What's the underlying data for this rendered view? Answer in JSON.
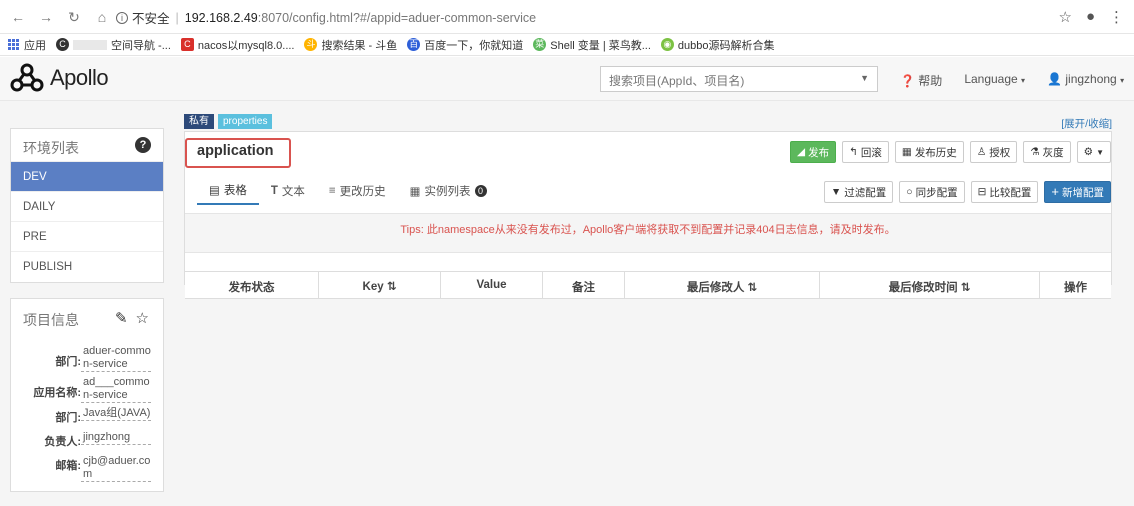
{
  "browser": {
    "nav_icons": [
      "back-arrow-icon",
      "forward-arrow-icon",
      "reload-icon",
      "home-icon"
    ],
    "security_label": "不安全",
    "url_host": "192.168.2.49",
    "url_rest": ":8070/config.html?#/appid=aduer-common-service",
    "bookmarks": [
      {
        "label": "应用"
      },
      {
        "label": "空间导航 -..."
      },
      {
        "label": "nacos以mysql8.0...."
      },
      {
        "label": "搜索结果 - 斗鱼"
      },
      {
        "label": "百度一下，你就知道"
      },
      {
        "label": "Shell 变量 | 菜鸟教..."
      },
      {
        "label": "dubbo源码解析合集"
      }
    ]
  },
  "header": {
    "logo_text": "Apollo",
    "search_placeholder": "搜索项目(AppId、项目名)",
    "help": "帮助",
    "language": "Language",
    "user": "jingzhong"
  },
  "env": {
    "title": "环境列表",
    "items": [
      "DEV",
      "DAILY",
      "PRE",
      "PUBLISH"
    ],
    "active": "DEV"
  },
  "project_info": {
    "title": "项目信息",
    "fields": [
      {
        "key": "部门:",
        "value": "aduer-common-service"
      },
      {
        "key": "应用名称:",
        "value": "ad___common-service"
      },
      {
        "key": "部门:",
        "value": "Java组(JAVA)"
      },
      {
        "key": "负责人:",
        "value": "jingzhong"
      },
      {
        "key": "邮箱:",
        "value": "cjb@aduer.com"
      }
    ]
  },
  "namespace": {
    "tag_private": "私有",
    "tag_format": "properties",
    "expand_toggle": "[展开/收缩]",
    "name": "application",
    "actions": {
      "publish": "发布",
      "rollback": "回滚",
      "publish_history": "发布历史",
      "authorize": "授权",
      "gray": "灰度"
    },
    "tabs": [
      {
        "label": "表格"
      },
      {
        "label": "文本"
      },
      {
        "label": "更改历史"
      },
      {
        "label": "实例列表"
      }
    ],
    "instance_count": "0",
    "config_actions": {
      "filter": "过滤配置",
      "sync": "同步配置",
      "compare": "比较配置",
      "add": "新增配置"
    },
    "tips": "Tips: 此namespace从来没有发布过，Apollo客户端将获取不到配置并记录404日志信息，请及时发布。",
    "columns": [
      "发布状态",
      "Key",
      "Value",
      "备注",
      "最后修改人",
      "最后修改时间",
      "操作"
    ]
  }
}
